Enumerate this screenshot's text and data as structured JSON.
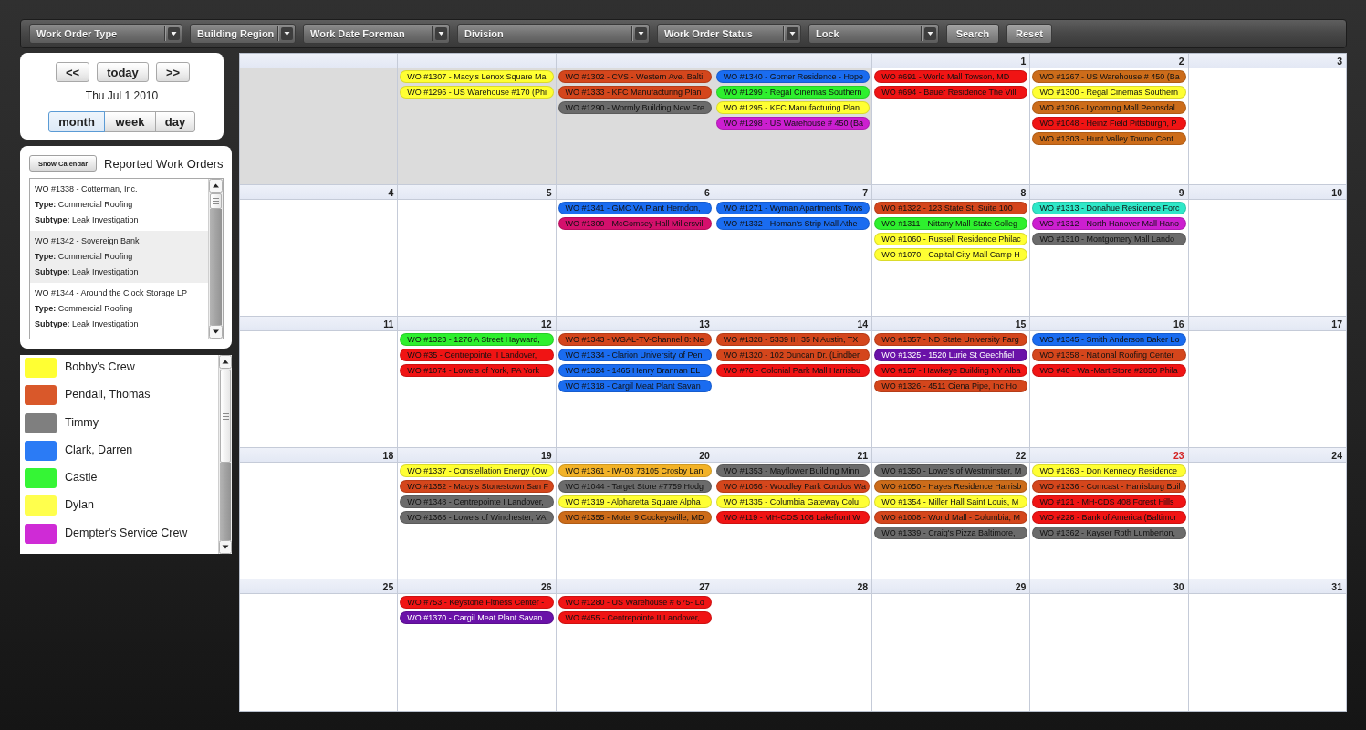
{
  "toolbar": {
    "filters": [
      {
        "label": "Work Order Type"
      },
      {
        "label": "Building Region"
      },
      {
        "label": "Work Date Foreman"
      },
      {
        "label": "Division"
      },
      {
        "label": "Work Order Status"
      },
      {
        "label": "Lock"
      }
    ],
    "buttons": [
      "Search",
      "Reset"
    ]
  },
  "navigator": {
    "buttons": [
      "<<",
      "today",
      ">>"
    ],
    "date": "Thu Jul 1 2010",
    "views": [
      {
        "label": "month",
        "selected": true
      },
      {
        "label": "week",
        "selected": false
      },
      {
        "label": "day",
        "selected": false
      }
    ]
  },
  "reported_work_orders": {
    "button": "Show Calendar",
    "title": "Reported Work Orders",
    "items": [
      {
        "title": "WO #1338 - Cotterman, Inc.",
        "type": "**Type:** Commercial Roofing",
        "subtype": "**Subtype:** Leak Investigation",
        "selected": false
      },
      {
        "title": "WO #1342 - Sovereign Bank",
        "type": "**Type:** Commercial Roofing",
        "subtype": "**Subtype:** Leak Investigation",
        "selected": true
      },
      {
        "title": "WO #1344 - Around the Clock Storage LP",
        "type": "**Type:** Commercial Roofing",
        "subtype": "**Subtype:** Leak Investigation",
        "selected": false
      }
    ]
  },
  "legend": [
    {
      "name": "Bobby's Crew",
      "color": "#ffff33"
    },
    {
      "name": "Pendall, Thomas",
      "color": "#d9582a"
    },
    {
      "name": "Timmy",
      "color": "#7f7f7f"
    },
    {
      "name": "Clark, Darren",
      "color": "#2b7bf5"
    },
    {
      "name": "Castle",
      "color": "#35f535"
    },
    {
      "name": "Dylan",
      "color": "#ffff4d"
    },
    {
      "name": "Dempter's Service Crew",
      "color": "#cf2bd6"
    }
  ],
  "calendar": {
    "weeks": [
      {
        "days": [
          {
            "other_month": true
          },
          {
            "other_month": true,
            "events": [
              {
                "label": "WO #1307 - Macy's Lenox Square Ma",
                "color": "#ffff33"
              },
              {
                "label": "WO #1296 - US Warehouse #170 (Phi",
                "color": "#ffff33"
              }
            ]
          },
          {
            "other_month": true,
            "events": [
              {
                "label": "WO #1302 - CVS - Western Ave. Balti",
                "color": "#d4461c"
              },
              {
                "label": "WO #1333 - KFC Manufacturing Plan",
                "color": "#d4461c"
              },
              {
                "label": "WO #1290 - Wormly Building New Fre",
                "color": "#6b6b6b"
              }
            ]
          },
          {
            "other_month": true,
            "events": [
              {
                "label": "WO #1340 - Gomer Residence - Hope",
                "color": "#1a6cf0"
              },
              {
                "label": "WO #1299 - Regal Cinemas Southern",
                "color": "#2ef02e"
              },
              {
                "label": "WO #1295 - KFC Manufacturing Plan",
                "color": "#ffff33"
              },
              {
                "label": "WO #1298 - US Warehouse # 450 (Ba",
                "color": "#cc1fd0"
              }
            ]
          },
          {
            "date": "1",
            "other_month": false,
            "highlighted": false,
            "events": [
              {
                "label": "WO #691 - World Mall Towson, MD",
                "color": "#f01414"
              },
              {
                "label": "WO #694 - Bauer Residence The Vill",
                "color": "#f01414"
              }
            ]
          },
          {
            "date": "2",
            "other_month": false,
            "highlighted": false,
            "events": [
              {
                "label": "WO #1267 - US Warehouse # 450 (Ba",
                "color": "#cc6c1a"
              },
              {
                "label": "WO #1300 - Regal Cinemas Southern",
                "color": "#ffff33"
              },
              {
                "label": "WO #1306 - Lycoming Mall Pennsdal",
                "color": "#cc6c1a"
              },
              {
                "label": "WO #1048 - Heinz Field Pittsburgh, P",
                "color": "#f01414"
              },
              {
                "label": "WO #1303 - Hunt Valley Towne Cent",
                "color": "#cc6c1a"
              }
            ]
          },
          {
            "date": "3",
            "other_month": false,
            "highlighted": false
          }
        ]
      },
      {
        "days": [
          {
            "date": "4",
            "other_month": false,
            "highlighted": false
          },
          {
            "date": "5",
            "other_month": false,
            "highlighted": false
          },
          {
            "date": "6",
            "other_month": false,
            "highlighted": false,
            "events": [
              {
                "label": "WO #1341 - GMC VA Plant Herndon,",
                "color": "#1a6cf0"
              },
              {
                "label": "WO #1309 - McComsey Hall Millersvil",
                "color": "#d4106c"
              }
            ]
          },
          {
            "date": "7",
            "other_month": false,
            "highlighted": false,
            "events": [
              {
                "label": "WO #1271 - Wyman Apartments Tows",
                "color": "#1a6cf0"
              },
              {
                "label": "WO #1332 - Homan's Strip Mall Athe",
                "color": "#1a6cf0"
              }
            ]
          },
          {
            "date": "8",
            "other_month": false,
            "highlighted": false,
            "events": [
              {
                "label": "WO #1322 - 123 State St. Suite 100",
                "color": "#d4461c"
              },
              {
                "label": "WO #1311 - Nittany Mall State Colleg",
                "color": "#2ef02e"
              },
              {
                "label": "WO #1060 - Russell Residence Philac",
                "color": "#ffff33"
              },
              {
                "label": "WO #1070 - Capital City Mall Camp H",
                "color": "#ffff33"
              }
            ]
          },
          {
            "date": "9",
            "other_month": false,
            "highlighted": false,
            "events": [
              {
                "label": "WO #1313 - Donahue Residence Forc",
                "color": "#2ee8c8"
              },
              {
                "label": "WO #1312 - North Hanover Mall Hano",
                "color": "#cc1fd0"
              },
              {
                "label": "WO #1310 - Montgomery Mall Lando",
                "color": "#6b6b6b"
              }
            ]
          },
          {
            "date": "10",
            "other_month": false,
            "highlighted": false
          }
        ]
      },
      {
        "days": [
          {
            "date": "11",
            "other_month": false,
            "highlighted": false
          },
          {
            "date": "12",
            "other_month": false,
            "highlighted": false,
            "events": [
              {
                "label": "WO #1323 - 1276 A Street Hayward,",
                "color": "#2ef02e"
              },
              {
                "label": "WO #35 - Centrepointe II Landover,",
                "color": "#f01414"
              },
              {
                "label": "WO #1074 - Lowe's of York, PA York",
                "color": "#f01414"
              }
            ]
          },
          {
            "date": "13",
            "other_month": false,
            "highlighted": false,
            "events": [
              {
                "label": "WO #1343 - WGAL-TV-Channel 8: Ne",
                "color": "#d4461c"
              },
              {
                "label": "WO #1334 - Clarion University of Pen",
                "color": "#1a6cf0"
              },
              {
                "label": "WO #1324 - 1465 Henry Brannan EL",
                "color": "#1a6cf0"
              },
              {
                "label": "WO #1318 - Cargil Meat Plant Savan",
                "color": "#1a6cf0"
              }
            ]
          },
          {
            "date": "14",
            "other_month": false,
            "highlighted": false,
            "events": [
              {
                "label": "WO #1328 - 5339 IH 35 N Austin, TX",
                "color": "#d4461c"
              },
              {
                "label": "WO #1320 - 102 Duncan Dr. (Lindber",
                "color": "#d4461c"
              },
              {
                "label": "WO #76 - Colonial Park Mall Harrisbu",
                "color": "#f01414"
              }
            ]
          },
          {
            "date": "15",
            "other_month": false,
            "highlighted": false,
            "events": [
              {
                "label": "WO #1357 - ND State University Farg",
                "color": "#d4461c"
              },
              {
                "label": "WO #1325 - 1520 Lurie St Geechfiel",
                "color": "#6a12a8"
              },
              {
                "label": "WO #157 - Hawkeye Building NY Alba",
                "color": "#f01414"
              },
              {
                "label": "WO #1326 - 4511 Ciena Pipe, Inc Ho",
                "color": "#d4461c"
              }
            ]
          },
          {
            "date": "16",
            "other_month": false,
            "highlighted": false,
            "events": [
              {
                "label": "WO #1345 - Smith Anderson Baker Lo",
                "color": "#1a6cf0"
              },
              {
                "label": "WO #1358 - National Roofing Center",
                "color": "#d4461c"
              },
              {
                "label": "WO #40 - Wal-Mart Store #2850 Phila",
                "color": "#f01414"
              }
            ]
          },
          {
            "date": "17",
            "other_month": false,
            "highlighted": false
          }
        ]
      },
      {
        "days": [
          {
            "date": "18",
            "other_month": false,
            "highlighted": false
          },
          {
            "date": "19",
            "other_month": false,
            "highlighted": false,
            "events": [
              {
                "label": "WO #1337 - Constellation Energy (Ow",
                "color": "#ffff33"
              },
              {
                "label": "WO #1352 - Macy's Stonestown San F",
                "color": "#d4461c"
              },
              {
                "label": "WO #1348 - Centrepointe I Landover,",
                "color": "#6b6b6b"
              },
              {
                "label": "WO #1368 - Lowe's of Winchester, VA",
                "color": "#6b6b6b"
              }
            ]
          },
          {
            "date": "20",
            "other_month": false,
            "highlighted": false,
            "events": [
              {
                "label": "WO #1361 - IW-03 73105 Crosby Lan",
                "color": "#f2b227"
              },
              {
                "label": "WO #1044 - Target Store #7759 Hodg",
                "color": "#6b6b6b"
              },
              {
                "label": "WO #1319 - Alpharetta Square Alpha",
                "color": "#ffff33"
              },
              {
                "label": "WO #1355 - Motel 9 Cockeysville, MD",
                "color": "#cc6c1a"
              }
            ]
          },
          {
            "date": "21",
            "other_month": false,
            "highlighted": false,
            "events": [
              {
                "label": "WO #1353 - Mayflower Building Minn",
                "color": "#6b6b6b"
              },
              {
                "label": "WO #1056 - Woodley Park Condos Wa",
                "color": "#d4461c"
              },
              {
                "label": "WO #1335 - Columbia Gateway Colu",
                "color": "#ffff33"
              },
              {
                "label": "WO #119 - MH-CDS 108 Lakefront W",
                "color": "#f01414"
              }
            ]
          },
          {
            "date": "22",
            "other_month": false,
            "highlighted": false,
            "events": [
              {
                "label": "WO #1350 - Lowe's of Westminster, M",
                "color": "#6b6b6b"
              },
              {
                "label": "WO #1050 - Hayes Residence Harrisb",
                "color": "#cc6c1a"
              },
              {
                "label": "WO #1354 - Miller Hall Saint Louis, M",
                "color": "#ffff33"
              },
              {
                "label": "WO #1008 - World Mall - Columbia, M",
                "color": "#d4461c"
              },
              {
                "label": "WO #1339 - Craig's Pizza Baltimore,",
                "color": "#6b6b6b"
              }
            ]
          },
          {
            "date": "23",
            "other_month": false,
            "highlighted": true,
            "events": [
              {
                "label": "WO #1363 - Don Kennedy Residence",
                "color": "#ffff33"
              },
              {
                "label": "WO #1336 - Comcast - Harrisburg Buil",
                "color": "#d4461c"
              },
              {
                "label": "WO #121 - MH-CDS 408 Forest Hills",
                "color": "#f01414"
              },
              {
                "label": "WO #228 - Bank of America (Baltimor",
                "color": "#f01414"
              },
              {
                "label": "WO #1362 - Kayser Roth Lumberton,",
                "color": "#6b6b6b"
              }
            ]
          },
          {
            "date": "24",
            "other_month": false,
            "highlighted": false
          }
        ]
      },
      {
        "days": [
          {
            "date": "25",
            "other_month": false,
            "highlighted": false
          },
          {
            "date": "26",
            "other_month": false,
            "highlighted": false,
            "events": [
              {
                "label": "WO #753 - Keystone Fitness Center -",
                "color": "#f01414"
              },
              {
                "label": "WO #1370 - Cargil Meat Plant Savan",
                "color": "#6a12a8"
              }
            ]
          },
          {
            "date": "27",
            "other_month": false,
            "highlighted": false,
            "events": [
              {
                "label": "WO #1280 - US Warehouse # 675- Lo",
                "color": "#f01414"
              },
              {
                "label": "WO #455 - Centrepointe II Landover,",
                "color": "#f01414"
              }
            ]
          },
          {
            "date": "28",
            "other_month": false,
            "highlighted": false
          },
          {
            "date": "29",
            "other_month": false,
            "highlighted": false
          },
          {
            "date": "30",
            "other_month": false,
            "highlighted": false
          },
          {
            "date": "31",
            "other_month": false,
            "highlighted": false
          }
        ]
      }
    ]
  }
}
